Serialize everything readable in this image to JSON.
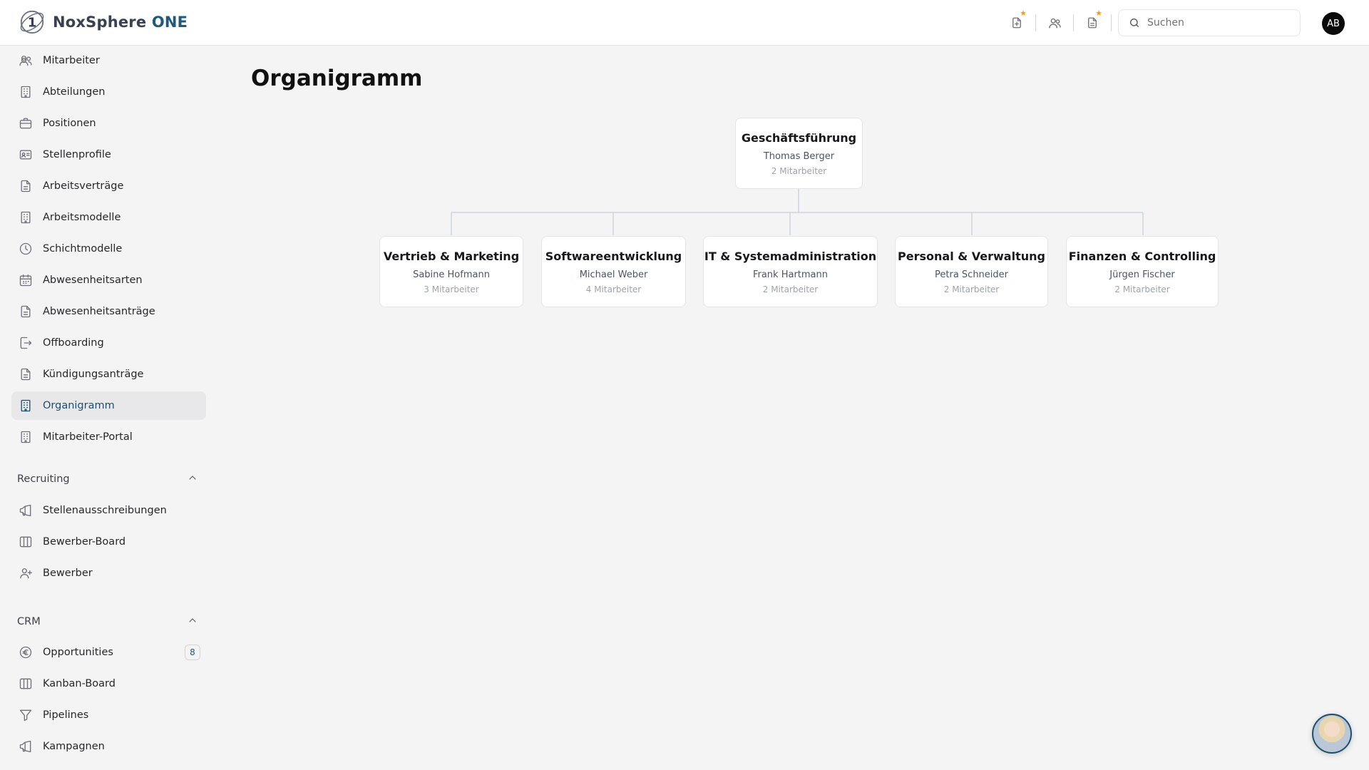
{
  "app": {
    "brand_name": "NoxSphere",
    "brand_suffix": "ONE",
    "brand_color": "#1e5a7e",
    "user_initials": "AB",
    "search_placeholder": "Suchen"
  },
  "header_icons": [
    "document-plus-icon",
    "users-icon",
    "document-icon"
  ],
  "sidebar": {
    "items": [
      {
        "label": "Mitarbeiter",
        "icon": "users-icon"
      },
      {
        "label": "Abteilungen",
        "icon": "building-icon"
      },
      {
        "label": "Positionen",
        "icon": "briefcase-icon"
      },
      {
        "label": "Stellenprofile",
        "icon": "id-card-icon"
      },
      {
        "label": "Arbeitsverträge",
        "icon": "document-icon"
      },
      {
        "label": "Arbeitsmodelle",
        "icon": "building-icon"
      },
      {
        "label": "Schichtmodelle",
        "icon": "clock-icon"
      },
      {
        "label": "Abwesenheitsarten",
        "icon": "calendar-icon"
      },
      {
        "label": "Abwesenheitsanträge",
        "icon": "document-icon"
      },
      {
        "label": "Offboarding",
        "icon": "logout-icon"
      },
      {
        "label": "Kündigungsanträge",
        "icon": "document-icon"
      },
      {
        "label": "Organigramm",
        "icon": "building-icon",
        "active": true
      },
      {
        "label": "Mitarbeiter-Portal",
        "icon": "building-icon"
      }
    ],
    "recruiting": {
      "title": "Recruiting",
      "items": [
        {
          "label": "Stellenausschreibungen",
          "icon": "megaphone-icon"
        },
        {
          "label": "Bewerber-Board",
          "icon": "columns-icon"
        },
        {
          "label": "Bewerber",
          "icon": "user-plus-icon"
        }
      ]
    },
    "crm": {
      "title": "CRM",
      "items": [
        {
          "label": "Opportunities",
          "icon": "euro-icon",
          "badge": "8"
        },
        {
          "label": "Kanban-Board",
          "icon": "columns-icon"
        },
        {
          "label": "Pipelines",
          "icon": "funnel-icon"
        },
        {
          "label": "Kampagnen",
          "icon": "megaphone-icon"
        }
      ]
    }
  },
  "main": {
    "title": "Organigramm",
    "org_root": {
      "name": "Geschäftsführung",
      "lead": "Thomas Berger",
      "count": "2 Mitarbeiter"
    },
    "org_children": [
      {
        "name": "Vertrieb & Marketing",
        "lead": "Sabine Hofmann",
        "count": "3 Mitarbeiter"
      },
      {
        "name": "Softwareentwicklung",
        "lead": "Michael Weber",
        "count": "4 Mitarbeiter"
      },
      {
        "name": "IT & Systemadministration",
        "lead": "Frank Hartmann",
        "count": "2 Mitarbeiter"
      },
      {
        "name": "Personal & Verwaltung",
        "lead": "Petra Schneider",
        "count": "2 Mitarbeiter"
      },
      {
        "name": "Finanzen & Controlling",
        "lead": "Jürgen Fischer",
        "count": "2 Mitarbeiter"
      }
    ]
  }
}
